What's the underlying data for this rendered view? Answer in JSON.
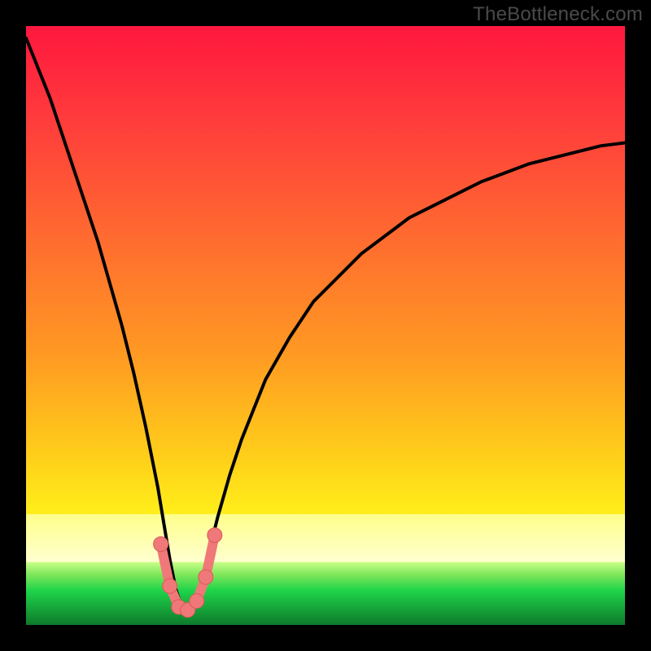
{
  "watermark": "TheBottleneck.com",
  "colors": {
    "frame": "#000000",
    "curve": "#000000",
    "marker_fill": "#f07878",
    "marker_stroke": "#d85a5a",
    "green_band_top": "#1fd44a",
    "green_band_bottom": "#0e7a2b"
  },
  "chart_data": {
    "type": "line",
    "title": "",
    "xlabel": "",
    "ylabel": "",
    "xlim": [
      0,
      100
    ],
    "ylim": [
      0,
      100
    ],
    "curve": {
      "name": "bottleneck-curve",
      "x": [
        0,
        2,
        4,
        6,
        8,
        10,
        12,
        14,
        16,
        18,
        20,
        22,
        23,
        24,
        25,
        26,
        27,
        28,
        29,
        30,
        32,
        34,
        36,
        38,
        40,
        44,
        48,
        52,
        56,
        60,
        64,
        68,
        72,
        76,
        80,
        84,
        88,
        92,
        96,
        100
      ],
      "y": [
        98,
        93,
        88,
        82,
        76,
        70,
        64,
        57,
        50,
        42,
        33,
        23,
        17,
        11,
        6,
        3,
        2,
        3,
        6,
        10,
        18,
        25,
        31,
        36,
        41,
        48,
        54,
        58,
        62,
        65,
        68,
        70,
        72,
        74,
        75.5,
        77,
        78,
        79,
        80,
        80.5
      ]
    },
    "markers": {
      "name": "highlight-points",
      "points": [
        {
          "x": 22.5,
          "y": 13.5
        },
        {
          "x": 24.0,
          "y": 6.5
        },
        {
          "x": 25.5,
          "y": 3.0
        },
        {
          "x": 27.0,
          "y": 2.5
        },
        {
          "x": 28.5,
          "y": 4.0
        },
        {
          "x": 30.0,
          "y": 8.0
        },
        {
          "x": 31.5,
          "y": 15.0
        }
      ]
    },
    "green_band": {
      "y_start": 0,
      "y_end": 10
    }
  }
}
